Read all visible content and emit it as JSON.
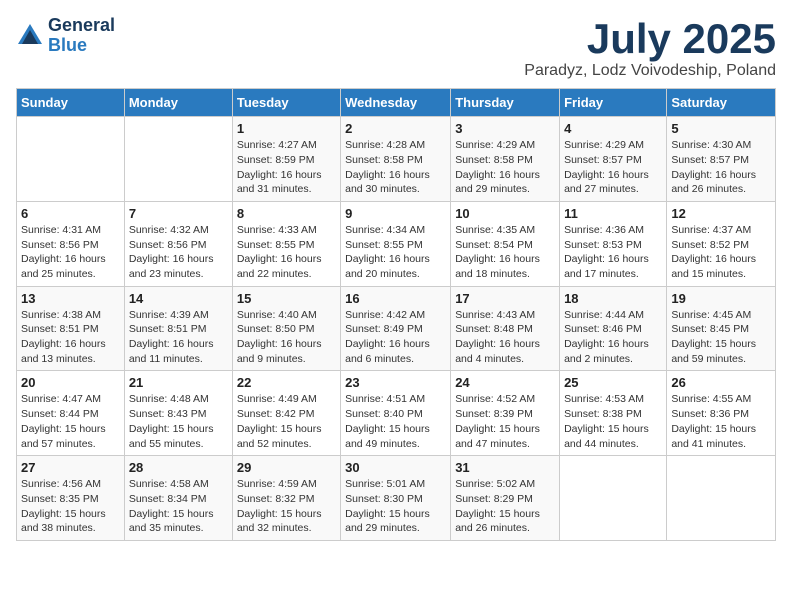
{
  "logo": {
    "general": "General",
    "blue": "Blue"
  },
  "title": "July 2025",
  "location": "Paradyz, Lodz Voivodeship, Poland",
  "days_of_week": [
    "Sunday",
    "Monday",
    "Tuesday",
    "Wednesday",
    "Thursday",
    "Friday",
    "Saturday"
  ],
  "weeks": [
    [
      {
        "day": "",
        "info": ""
      },
      {
        "day": "",
        "info": ""
      },
      {
        "day": "1",
        "info": "Sunrise: 4:27 AM\nSunset: 8:59 PM\nDaylight: 16 hours\nand 31 minutes."
      },
      {
        "day": "2",
        "info": "Sunrise: 4:28 AM\nSunset: 8:58 PM\nDaylight: 16 hours\nand 30 minutes."
      },
      {
        "day": "3",
        "info": "Sunrise: 4:29 AM\nSunset: 8:58 PM\nDaylight: 16 hours\nand 29 minutes."
      },
      {
        "day": "4",
        "info": "Sunrise: 4:29 AM\nSunset: 8:57 PM\nDaylight: 16 hours\nand 27 minutes."
      },
      {
        "day": "5",
        "info": "Sunrise: 4:30 AM\nSunset: 8:57 PM\nDaylight: 16 hours\nand 26 minutes."
      }
    ],
    [
      {
        "day": "6",
        "info": "Sunrise: 4:31 AM\nSunset: 8:56 PM\nDaylight: 16 hours\nand 25 minutes."
      },
      {
        "day": "7",
        "info": "Sunrise: 4:32 AM\nSunset: 8:56 PM\nDaylight: 16 hours\nand 23 minutes."
      },
      {
        "day": "8",
        "info": "Sunrise: 4:33 AM\nSunset: 8:55 PM\nDaylight: 16 hours\nand 22 minutes."
      },
      {
        "day": "9",
        "info": "Sunrise: 4:34 AM\nSunset: 8:55 PM\nDaylight: 16 hours\nand 20 minutes."
      },
      {
        "day": "10",
        "info": "Sunrise: 4:35 AM\nSunset: 8:54 PM\nDaylight: 16 hours\nand 18 minutes."
      },
      {
        "day": "11",
        "info": "Sunrise: 4:36 AM\nSunset: 8:53 PM\nDaylight: 16 hours\nand 17 minutes."
      },
      {
        "day": "12",
        "info": "Sunrise: 4:37 AM\nSunset: 8:52 PM\nDaylight: 16 hours\nand 15 minutes."
      }
    ],
    [
      {
        "day": "13",
        "info": "Sunrise: 4:38 AM\nSunset: 8:51 PM\nDaylight: 16 hours\nand 13 minutes."
      },
      {
        "day": "14",
        "info": "Sunrise: 4:39 AM\nSunset: 8:51 PM\nDaylight: 16 hours\nand 11 minutes."
      },
      {
        "day": "15",
        "info": "Sunrise: 4:40 AM\nSunset: 8:50 PM\nDaylight: 16 hours\nand 9 minutes."
      },
      {
        "day": "16",
        "info": "Sunrise: 4:42 AM\nSunset: 8:49 PM\nDaylight: 16 hours\nand 6 minutes."
      },
      {
        "day": "17",
        "info": "Sunrise: 4:43 AM\nSunset: 8:48 PM\nDaylight: 16 hours\nand 4 minutes."
      },
      {
        "day": "18",
        "info": "Sunrise: 4:44 AM\nSunset: 8:46 PM\nDaylight: 16 hours\nand 2 minutes."
      },
      {
        "day": "19",
        "info": "Sunrise: 4:45 AM\nSunset: 8:45 PM\nDaylight: 15 hours\nand 59 minutes."
      }
    ],
    [
      {
        "day": "20",
        "info": "Sunrise: 4:47 AM\nSunset: 8:44 PM\nDaylight: 15 hours\nand 57 minutes."
      },
      {
        "day": "21",
        "info": "Sunrise: 4:48 AM\nSunset: 8:43 PM\nDaylight: 15 hours\nand 55 minutes."
      },
      {
        "day": "22",
        "info": "Sunrise: 4:49 AM\nSunset: 8:42 PM\nDaylight: 15 hours\nand 52 minutes."
      },
      {
        "day": "23",
        "info": "Sunrise: 4:51 AM\nSunset: 8:40 PM\nDaylight: 15 hours\nand 49 minutes."
      },
      {
        "day": "24",
        "info": "Sunrise: 4:52 AM\nSunset: 8:39 PM\nDaylight: 15 hours\nand 47 minutes."
      },
      {
        "day": "25",
        "info": "Sunrise: 4:53 AM\nSunset: 8:38 PM\nDaylight: 15 hours\nand 44 minutes."
      },
      {
        "day": "26",
        "info": "Sunrise: 4:55 AM\nSunset: 8:36 PM\nDaylight: 15 hours\nand 41 minutes."
      }
    ],
    [
      {
        "day": "27",
        "info": "Sunrise: 4:56 AM\nSunset: 8:35 PM\nDaylight: 15 hours\nand 38 minutes."
      },
      {
        "day": "28",
        "info": "Sunrise: 4:58 AM\nSunset: 8:34 PM\nDaylight: 15 hours\nand 35 minutes."
      },
      {
        "day": "29",
        "info": "Sunrise: 4:59 AM\nSunset: 8:32 PM\nDaylight: 15 hours\nand 32 minutes."
      },
      {
        "day": "30",
        "info": "Sunrise: 5:01 AM\nSunset: 8:30 PM\nDaylight: 15 hours\nand 29 minutes."
      },
      {
        "day": "31",
        "info": "Sunrise: 5:02 AM\nSunset: 8:29 PM\nDaylight: 15 hours\nand 26 minutes."
      },
      {
        "day": "",
        "info": ""
      },
      {
        "day": "",
        "info": ""
      }
    ]
  ]
}
